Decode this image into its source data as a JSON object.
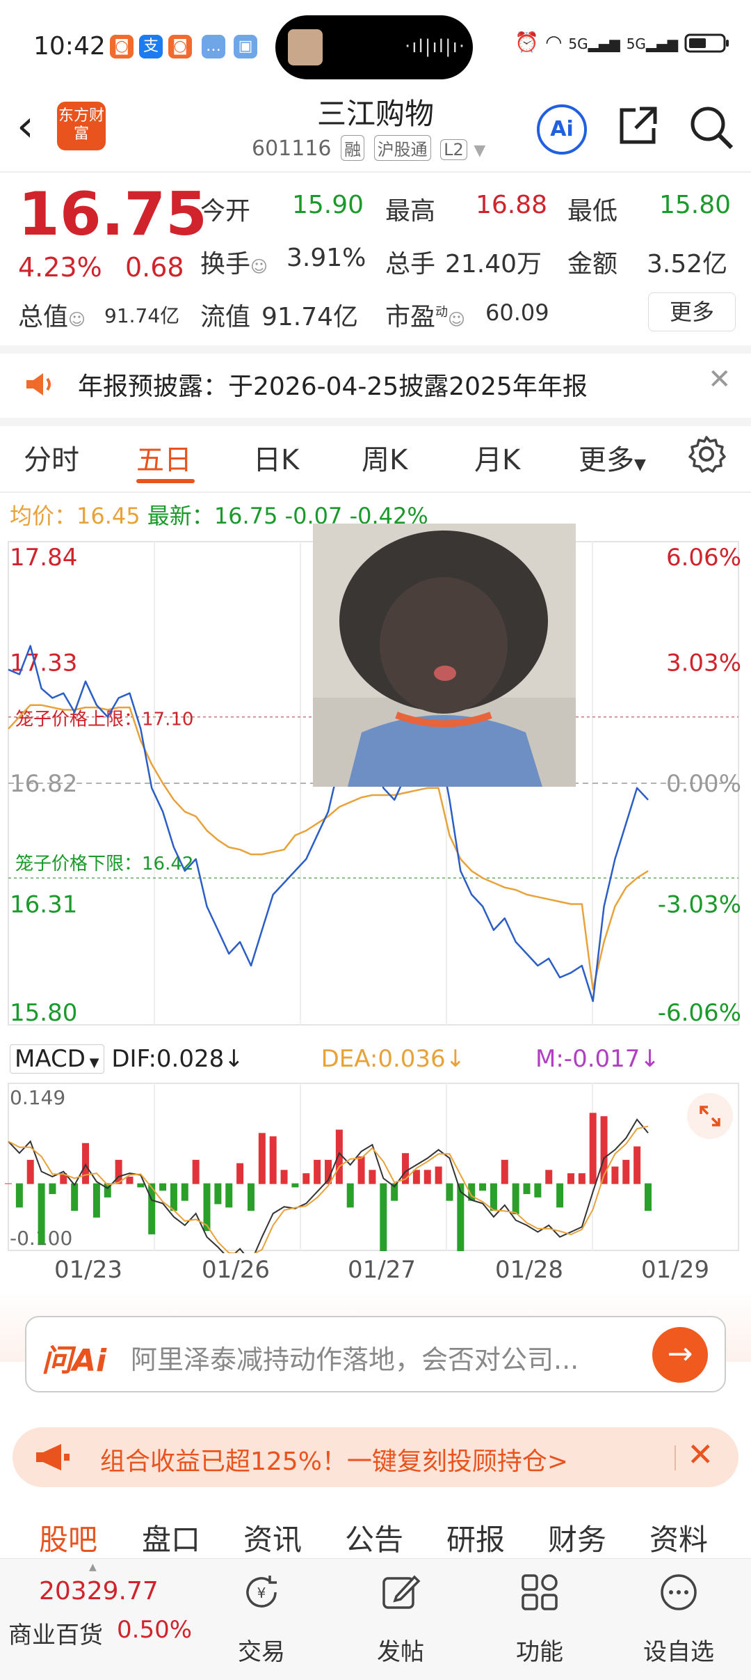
{
  "status_bar": {
    "time": "10:42",
    "network": "5G",
    "wave": "·ıl|ıl|ı·"
  },
  "header": {
    "stock_name": "三江购物",
    "stock_code": "601116",
    "tags": [
      "融",
      "沪股通",
      "L2"
    ],
    "logo_text": "东方财富",
    "ai_label": "Ai"
  },
  "quote": {
    "price": "16.75",
    "change_pct": "4.23%",
    "change": "0.68",
    "open_label": "今开",
    "open": "15.90",
    "high_label": "最高",
    "high": "16.88",
    "low_label": "最低",
    "low": "15.80",
    "turnover_label": "换手",
    "turnover": "3.91%",
    "volume_label": "总手",
    "volume": "21.40万",
    "amount_label": "金额",
    "amount": "3.52亿",
    "mktcap_label": "总值",
    "mktcap": "91.74亿",
    "float_label": "流值",
    "float_cap": "91.74亿",
    "pe_label": "市盈",
    "pe_sup": "动",
    "pe": "60.09",
    "more_label": "更多"
  },
  "notice": {
    "text": "年报预披露：于2026-04-25披露2025年年报"
  },
  "chart_tabs": [
    "分时",
    "五日",
    "日K",
    "周K",
    "月K",
    "更多"
  ],
  "info_line": {
    "avg_label": "均价：",
    "avg": "16.45",
    "latest_label": "最新：",
    "latest": "16.75",
    "diff": "-0.07",
    "diff_pct": "-0.42%"
  },
  "chart_data": {
    "type": "line",
    "y_ticks_left": [
      "17.84",
      "17.33",
      "16.82",
      "16.31",
      "15.80"
    ],
    "y_ticks_right": [
      "6.06%",
      "3.03%",
      "0.00%",
      "-3.03%",
      "-6.06%"
    ],
    "ylim": [
      15.8,
      17.84
    ],
    "prev_close": 16.82,
    "cage_upper_label": "笼子价格上限：17.10",
    "cage_upper": 17.1,
    "cage_lower_label": "笼子价格下限：16.42",
    "cage_lower": 16.42,
    "days": [
      "01/23",
      "01/26",
      "01/27",
      "01/28",
      "01/29"
    ],
    "series": [
      {
        "values": [
          17.3,
          17.28,
          17.4,
          17.22,
          17.18,
          17.2,
          17.12,
          17.25,
          17.15,
          17.1,
          17.18,
          17.2,
          17.05,
          16.8,
          16.7,
          16.55,
          16.45,
          16.5,
          16.3,
          16.2,
          16.1,
          16.15,
          16.05,
          16.2,
          16.35,
          16.4,
          16.45,
          16.5,
          16.6,
          16.7,
          16.9,
          16.85,
          16.95,
          17.0,
          16.8,
          16.75,
          16.85,
          16.9,
          16.95,
          17.0,
          16.75,
          16.45,
          16.35,
          16.3,
          16.2,
          16.25,
          16.15,
          16.1,
          16.05,
          16.08,
          16.0,
          16.02,
          16.05,
          15.9,
          16.3,
          16.5,
          16.65,
          16.8,
          16.75
        ]
      },
      {
        "values": [
          17.05,
          17.1,
          17.15,
          17.15,
          17.14,
          17.13,
          17.13,
          17.14,
          17.14,
          17.13,
          17.14,
          17.14,
          17.0,
          16.9,
          16.82,
          16.75,
          16.7,
          16.68,
          16.62,
          16.58,
          16.55,
          16.54,
          16.52,
          16.52,
          16.53,
          16.54,
          16.6,
          16.62,
          16.65,
          16.68,
          16.72,
          16.74,
          16.76,
          16.77,
          16.77,
          16.77,
          16.78,
          16.79,
          16.8,
          16.8,
          16.6,
          16.5,
          16.45,
          16.42,
          16.4,
          16.38,
          16.37,
          16.35,
          16.34,
          16.33,
          16.32,
          16.31,
          16.31,
          15.95,
          16.15,
          16.3,
          16.38,
          16.42,
          16.45
        ]
      }
    ],
    "macd": {
      "dif": "0.028",
      "dea": "0.036",
      "m": "-0.017",
      "ymax": "0.149",
      "ymin": "-0.100"
    }
  },
  "macd_labels": {
    "name": "MACD",
    "dif_label": "DIF:",
    "dea_label": "DEA:",
    "m_label": "M:"
  },
  "ask_ai": {
    "logo": "问Ai",
    "placeholder": "阿里泽泰减持动作落地，会否对公司..."
  },
  "promo": {
    "text": "组合收益已超125%！一键复刻投顾持仓>"
  },
  "bottom_tabs": [
    "股吧",
    "盘口",
    "资讯",
    "公告",
    "研报",
    "财务",
    "资料"
  ],
  "bottom_bar": {
    "index_value": "20329.77",
    "index_name": "商业百货",
    "index_pct": "0.50%",
    "nav": [
      "交易",
      "发帖",
      "功能",
      "设自选"
    ]
  },
  "colors": {
    "accent": "#e8531e",
    "up": "#d0232b",
    "down": "#1a9a2a",
    "avg_line": "#e8a23a",
    "price_line": "#2a5ec6"
  }
}
